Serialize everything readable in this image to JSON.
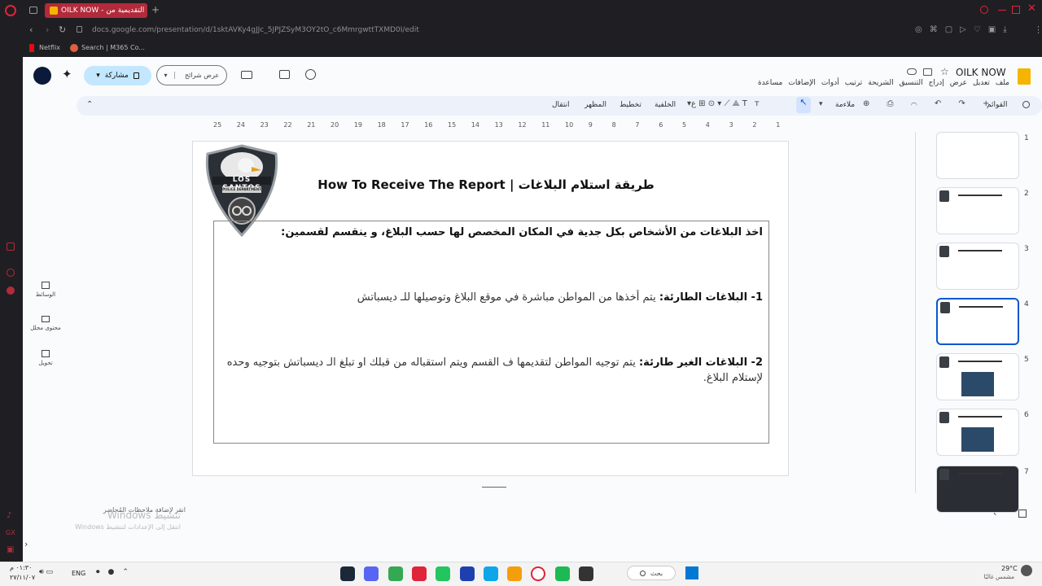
{
  "browser": {
    "tab_title": "OILK NOW - التقديمية من ...",
    "url": "docs.google.com/presentation/d/1sktAVKy4gJJc_5JPJZSyM3OY2tO_c6MmrgwttTXMD0I/edit",
    "bookmarks": [
      "Netflix",
      "Search | M365 Co..."
    ]
  },
  "app": {
    "doc_title": "OILK NOW",
    "menu": [
      "ملف",
      "تعديل",
      "عرض",
      "إدراج",
      "التنسيق",
      "الشريحة",
      "ترتيب",
      "أدوات",
      "الإضافات",
      "مساعدة"
    ],
    "share_label": "مشاركة",
    "slideshow_label": "عرض شرائح",
    "toolbar": {
      "menus_label": "القوائم",
      "fit_label": "ملاءمة",
      "background": "الخلفية",
      "layout": "تخطيط",
      "theme": "المظهر",
      "transition": "انتقال"
    },
    "side_panel": [
      "الوسائط",
      "محتوى مجلل",
      "تحويل"
    ],
    "notes_placeholder": "انقر لإضافة ملاحظات المُحاضر",
    "activate": {
      "title": "تنشيط Windows",
      "subtitle": "انتقل إلى الإعدادات لتنشيط Windows"
    }
  },
  "ruler": [
    "25",
    "24",
    "23",
    "22",
    "21",
    "20",
    "19",
    "18",
    "17",
    "16",
    "15",
    "14",
    "13",
    "12",
    "11",
    "10",
    "9",
    "8",
    "7",
    "6",
    "5",
    "4",
    "3",
    "2",
    "1"
  ],
  "slide": {
    "logo_text": "LOS SANTOS",
    "logo_sub": "POLICE DEPARTMENT",
    "title": "طريقة استلام البلاغات | How To Receive The Report",
    "intro": "اخذ البلاغات من الأشخاص بكل جدية في المكان المخصص لها حسب البلاغ، و ينقسم لقسمين:",
    "item1_label": "1- البلاغات الطارئة:",
    "item1_text": " يتم أخذها من المواطن مباشرة في موقع البلاغ وتوصيلها للـ ديسباتش",
    "item2_label": "2- البلاغات الغير طارئة:",
    "item2_text": " يتم توجيه المواطن لتقديمها ف القسم ويتم استقباله من قبلك او تبلغ الـ ديسباتش بتوجيه وحده لإستلام البلاغ."
  },
  "filmstrip": [
    "1",
    "2",
    "3",
    "4",
    "5",
    "6",
    "7"
  ],
  "taskbar": {
    "search": "بحث",
    "weather_temp": "29°C",
    "weather_text": "مشمس غالبًا",
    "lang": "ENG",
    "time": "٠١:٣٠ م",
    "date": "٢٧/١١/٠٧"
  }
}
